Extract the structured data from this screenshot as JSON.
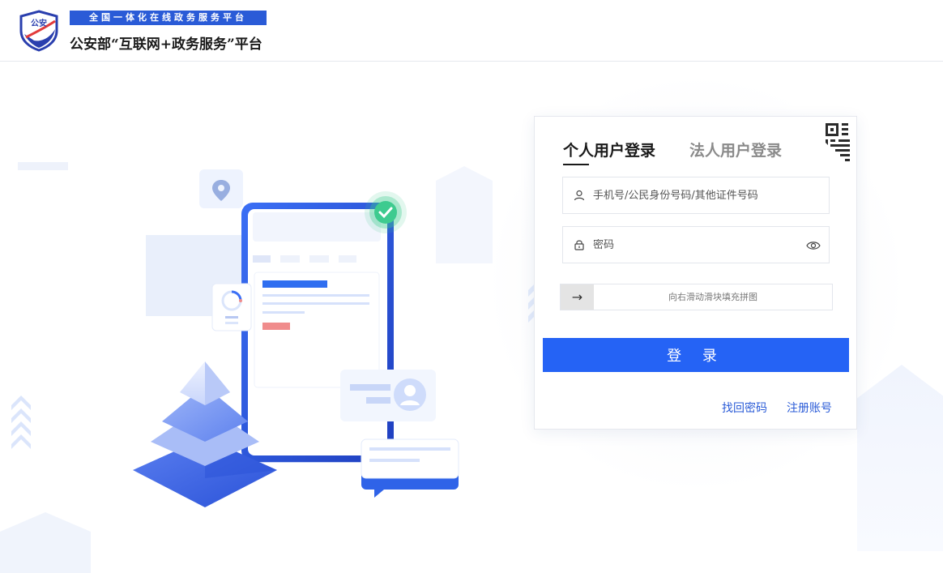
{
  "header": {
    "logo_text": "公安",
    "banner": "全国一体化在线政务服务平台",
    "title": "公安部“互联网+政务服务”平台"
  },
  "login": {
    "tabs": [
      {
        "label": "个人用户登录",
        "active": true
      },
      {
        "label": "法人用户登录",
        "active": false
      }
    ],
    "username_placeholder": "手机号/公民身份号码/其他证件号码",
    "password_placeholder": "密码",
    "slider_arrow": "→",
    "slider_text": "向右滑动滑块填充拼图",
    "submit_label": "登 录",
    "forgot_label": "找回密码",
    "register_label": "注册账号"
  },
  "colors": {
    "primary": "#2563f5",
    "brand_blue": "#2a5bd7",
    "success_green": "#3ecb8f",
    "accent_red": "#f08080"
  },
  "icons": {
    "qr": "qr-code-icon",
    "user": "user-icon",
    "lock": "lock-icon",
    "eye": "eye-icon",
    "location": "location-pin-icon",
    "check": "check-circle-icon"
  }
}
